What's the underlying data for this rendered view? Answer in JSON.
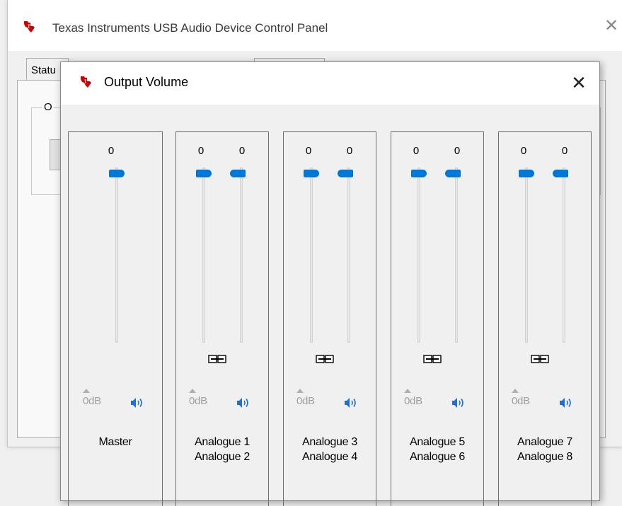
{
  "main_window": {
    "title": "Texas Instruments USB Audio Device Control Panel",
    "close_glyph": "✕",
    "tab_visible_label": "Statu",
    "group_visible_label": "O"
  },
  "dialog": {
    "title": "Output Volume",
    "close_glyph": "✕",
    "channels": [
      {
        "id": "master",
        "volumes": [
          "0"
        ],
        "db_label": "0dB",
        "name_line1": "Master",
        "name_line2": ""
      },
      {
        "id": "analogue-1-2",
        "volumes": [
          "0",
          "0"
        ],
        "db_label": "0dB",
        "name_line1": "Analogue 1",
        "name_line2": "Analogue 2"
      },
      {
        "id": "analogue-3-4",
        "volumes": [
          "0",
          "0"
        ],
        "db_label": "0dB",
        "name_line1": "Analogue 3",
        "name_line2": "Analogue 4"
      },
      {
        "id": "analogue-5-6",
        "volumes": [
          "0",
          "0"
        ],
        "db_label": "0dB",
        "name_line1": "Analogue 5",
        "name_line2": "Analogue 6"
      },
      {
        "id": "analogue-7-8",
        "volumes": [
          "0",
          "0"
        ],
        "db_label": "0dB",
        "name_line1": "Analogue 7",
        "name_line2": "Analogue 8"
      }
    ],
    "slider_level": 1.0
  },
  "icons": {
    "logo": "texas-instruments-logo-icon",
    "speaker": "speaker-icon",
    "link": "stereo-link-icon"
  },
  "colors": {
    "accent": "#0078d7",
    "logo_red": "#cc0000",
    "disabled_text": "#a0a0a0"
  }
}
